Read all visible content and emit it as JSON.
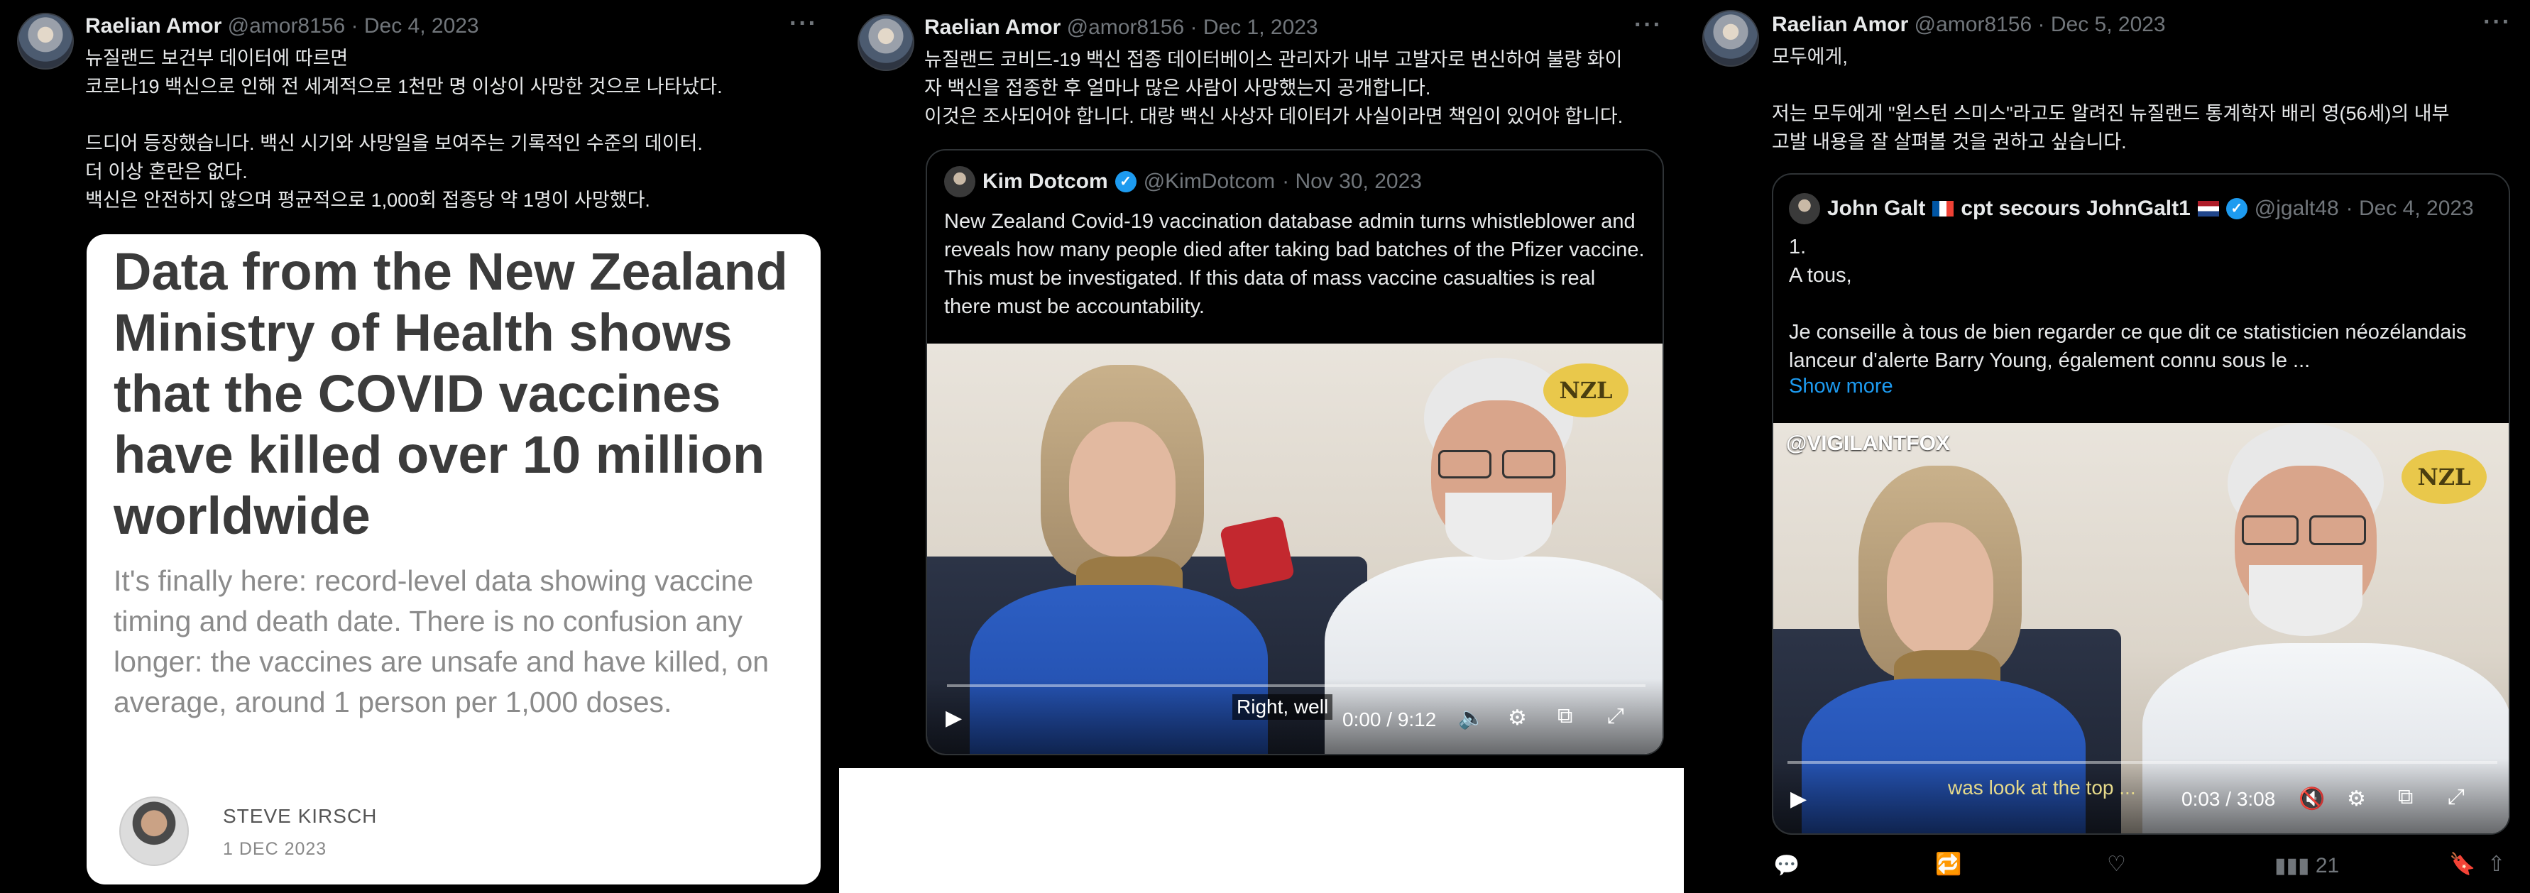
{
  "tweet1": {
    "name": "Raelian Amor",
    "handle": "@amor8156",
    "date": "· Dec 4, 2023",
    "text": "뉴질랜드 보건부 데이터에 따르면\n코로나19 백신으로 인해 전 세계적으로 1천만 명 이상이 사망한 것으로 나타났다.\n\n드디어 등장했습니다. 백신 시기와 사망일을 보여주는 기록적인 수준의 데이터.\n더 이상 혼란은 없다.\n백신은 안전하지 않으며 평균적으로 1,000회 접종당 약 1명이 사망했다.",
    "card": {
      "title": "Data from the New Zealand Ministry of Health shows that the COVID vaccines have killed over 10 million worldwide",
      "subtitle": "It's finally here: record-level data showing vaccine timing and death date. There is no confusion any longer: the vaccines are unsafe and have killed, on average, around 1 person per 1,000 doses.",
      "author": "STEVE KIRSCH",
      "author_date": "1 DEC 2023"
    }
  },
  "tweet2": {
    "name": "Raelian Amor",
    "handle": "@amor8156",
    "date": "· Dec 1, 2023",
    "text": "뉴질랜드 코비드-19 백신 접종 데이터베이스 관리자가 내부 고발자로 변신하여 불량 화이\n자 백신을 접종한 후 얼마나 많은 사람이 사망했는지 공개합니다.\n이것은 조사되어야 합니다. 대량 백신 사상자 데이터가 사실이라면 책임이 있어야 합니다.",
    "quote": {
      "name": "Kim Dotcom",
      "handle": "@KimDotcom",
      "date": "· Nov 30, 2023",
      "text": "New Zealand Covid-19 vaccination database admin turns whistleblower and reveals how many people died after taking bad batches of the Pfizer vaccine. This must be investigated. If this data of mass vaccine casualties is real there must be accountability.",
      "video": {
        "logo": "NZL",
        "caption": "Right, well",
        "time": "0:00 / 9:12"
      }
    }
  },
  "tweet3": {
    "name": "Raelian Amor",
    "handle": "@amor8156",
    "date": "· Dec 5, 2023",
    "text": "모두에게,\n\n저는 모두에게 \"윈스턴 스미스\"라고도 알려진 뉴질랜드 통계학자 배리 영(56세)의 내부\n고발 내용을 잘 살펴볼 것을 권하고 싶습니다.",
    "quote": {
      "name": "John Galt",
      "name2": "cpt secours JohnGalt1",
      "handle": "@jgalt48",
      "date": "· Dec 4, 2023",
      "text": "1.\nA tous,\n\nJe conseille à tous de bien regarder ce que dit ce statisticien néozélandais lanceur d'alerte Barry Young, également connu sous le ...",
      "show_more": "Show more",
      "video": {
        "watermark": "@VIGILANTFOX",
        "logo": "NZL",
        "caption": "was look at the top ...",
        "time": "0:03 / 3:08"
      }
    },
    "actions": {
      "views": "21"
    }
  }
}
